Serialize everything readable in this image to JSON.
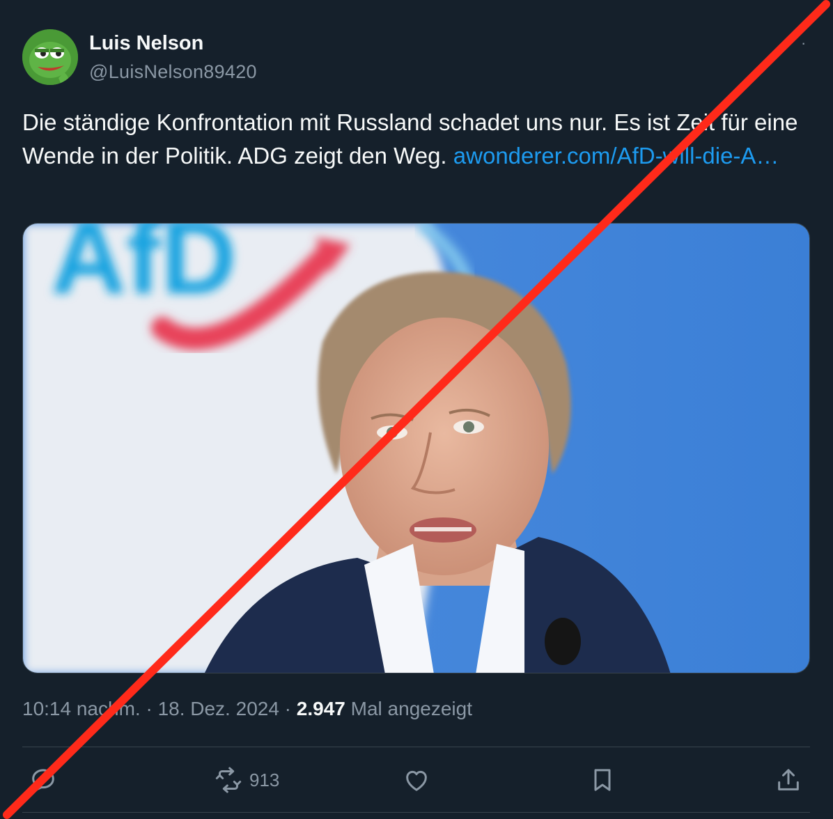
{
  "author": {
    "display_name": "Luis Nelson",
    "handle": "@LuisNelson89420",
    "avatar_icon": "pepe-frog-avatar"
  },
  "tweet": {
    "text": "Die ständige Konfrontation mit Russland schadet uns nur. Es ist Zeit für eine Wende in der Politik. ADG zeigt den Weg. ",
    "link_text": "awonderer.com/AfD-will-die-A…",
    "image_logo_text": "AfD"
  },
  "meta": {
    "time": "10:14 nachm.",
    "separator": " · ",
    "date": "18. Dez. 2024",
    "views_count": "2.947",
    "views_label": " Mal angezeigt"
  },
  "actions": {
    "reply_icon": "reply-icon",
    "retweet_icon": "retweet-icon",
    "retweet_count": "913",
    "like_icon": "heart-icon",
    "bookmark_icon": "bookmark-icon",
    "share_icon": "share-icon"
  },
  "colors": {
    "background": "#15202b",
    "link": "#1d9bf0",
    "muted": "#8b98a5",
    "cross_line": "#ff2a1a"
  }
}
